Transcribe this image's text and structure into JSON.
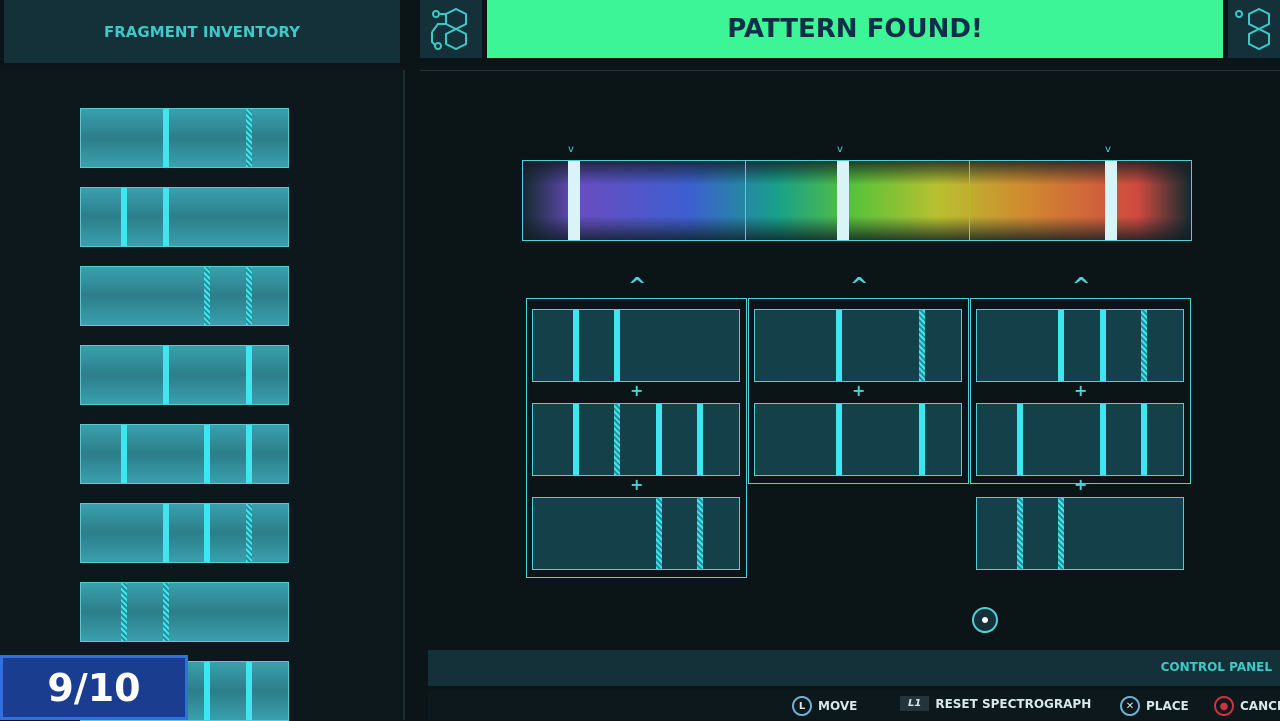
{
  "header": {
    "inventory_title": "FRAGMENT INVENTORY",
    "banner": "PATTERN FOUND!",
    "hex_icon": "molecule-icon"
  },
  "colors": {
    "banner": "#3cf596",
    "accent": "#3ec9c9",
    "counter_bg": "#1a3d8f"
  },
  "inventory": [
    [
      {
        "slot": 2,
        "t": "s"
      },
      {
        "slot": 4,
        "t": "h"
      }
    ],
    [
      {
        "slot": 1,
        "t": "s"
      },
      {
        "slot": 2,
        "t": "s"
      }
    ],
    [
      {
        "slot": 3,
        "t": "h"
      },
      {
        "slot": 4,
        "t": "h"
      }
    ],
    [
      {
        "slot": 2,
        "t": "s"
      },
      {
        "slot": 4,
        "t": "s"
      }
    ],
    [
      {
        "slot": 1,
        "t": "s"
      },
      {
        "slot": 3,
        "t": "s"
      },
      {
        "slot": 4,
        "t": "s"
      }
    ],
    [
      {
        "slot": 2,
        "t": "s"
      },
      {
        "slot": 3,
        "t": "s"
      },
      {
        "slot": 4,
        "t": "h"
      }
    ],
    [
      {
        "slot": 1,
        "t": "h"
      },
      {
        "slot": 2,
        "t": "h"
      }
    ],
    [
      {
        "slot": 3,
        "t": "s"
      },
      {
        "slot": 4,
        "t": "s"
      }
    ]
  ],
  "board": [
    [
      [
        {
          "slot": 1,
          "t": "s"
        },
        {
          "slot": 2,
          "t": "s"
        }
      ],
      [
        {
          "slot": 1,
          "t": "s"
        },
        {
          "slot": 2,
          "t": "h"
        },
        {
          "slot": 3,
          "t": "s"
        },
        {
          "slot": 4,
          "t": "s"
        }
      ],
      [
        {
          "slot": 3,
          "t": "h"
        },
        {
          "slot": 4,
          "t": "h"
        }
      ]
    ],
    [
      [
        {
          "slot": 2,
          "t": "s"
        },
        {
          "slot": 4,
          "t": "h"
        }
      ],
      [
        {
          "slot": 2,
          "t": "s"
        },
        {
          "slot": 4,
          "t": "s"
        }
      ]
    ],
    [
      [
        {
          "slot": 2,
          "t": "s"
        },
        {
          "slot": 3,
          "t": "s"
        },
        {
          "slot": 4,
          "t": "h"
        }
      ],
      [
        {
          "slot": 1,
          "t": "s"
        },
        {
          "slot": 3,
          "t": "s"
        },
        {
          "slot": 4,
          "t": "s"
        }
      ],
      [
        {
          "slot": 1,
          "t": "h"
        },
        {
          "slot": 2,
          "t": "h"
        }
      ]
    ]
  ],
  "counter": "9/10",
  "control_panel": {
    "title": "CONTROL PANEL",
    "controls": [
      {
        "key": "L",
        "label": "MOVE"
      },
      {
        "key": "L1",
        "label": "RESET SPECTROGRAPH"
      },
      {
        "key": "✕",
        "label": "PLACE"
      },
      {
        "key": "●",
        "label": "CANCEL"
      }
    ]
  }
}
